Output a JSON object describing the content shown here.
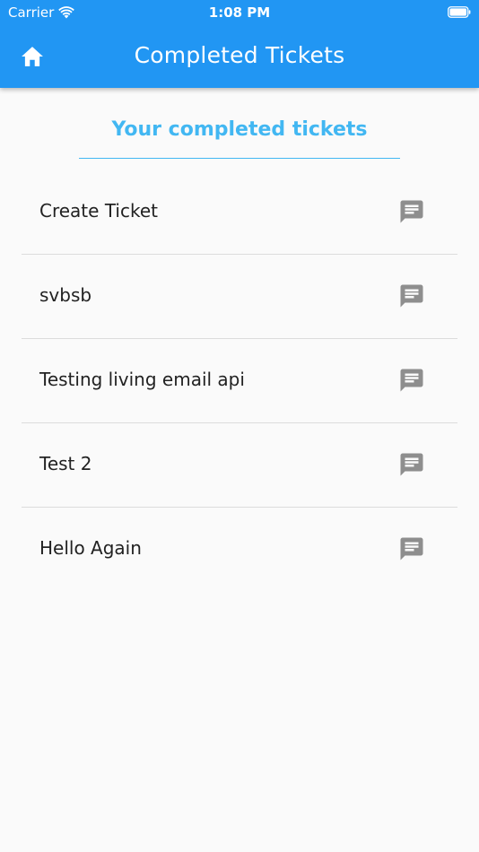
{
  "status_bar": {
    "carrier": "Carrier",
    "time": "1:08 PM"
  },
  "app_bar": {
    "title": "Completed Tickets",
    "home_icon": "home-icon",
    "background_color": "#2196f3"
  },
  "content": {
    "heading": "Your completed tickets",
    "heading_color": "#42b7f2"
  },
  "tickets": [
    {
      "title": "Create Ticket",
      "icon": "chat-icon"
    },
    {
      "title": "svbsb",
      "icon": "chat-icon"
    },
    {
      "title": "Testing living email api",
      "icon": "chat-icon"
    },
    {
      "title": "Test 2",
      "icon": "chat-icon"
    },
    {
      "title": "Hello Again",
      "icon": "chat-icon"
    }
  ]
}
